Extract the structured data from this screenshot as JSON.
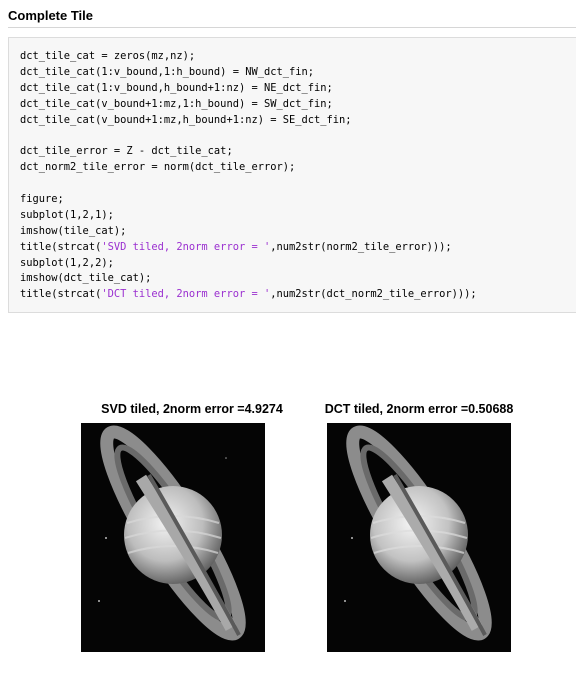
{
  "section": {
    "title": "Complete Tile"
  },
  "code": [
    [
      {
        "t": "dct_tile_cat = zeros(mz,nz);"
      }
    ],
    [
      {
        "t": "dct_tile_cat(1:v_bound,1:h_bound) = NW_dct_fin;"
      }
    ],
    [
      {
        "t": "dct_tile_cat(1:v_bound,h_bound+1:nz) = NE_dct_fin;"
      }
    ],
    [
      {
        "t": "dct_tile_cat(v_bound+1:mz,1:h_bound) = SW_dct_fin;"
      }
    ],
    [
      {
        "t": "dct_tile_cat(v_bound+1:mz,h_bound+1:nz) = SE_dct_fin;"
      }
    ],
    [
      {
        "t": ""
      }
    ],
    [
      {
        "t": "dct_tile_error = Z - dct_tile_cat;"
      }
    ],
    [
      {
        "t": "dct_norm2_tile_error = norm(dct_tile_error);"
      }
    ],
    [
      {
        "t": ""
      }
    ],
    [
      {
        "t": "figure;"
      }
    ],
    [
      {
        "t": "subplot(1,2,1);"
      }
    ],
    [
      {
        "t": "imshow(tile_cat);"
      }
    ],
    [
      {
        "t": "title(strcat("
      },
      {
        "t": "'SVD tiled, 2norm error = '",
        "s": true
      },
      {
        "t": ",num2str(norm2_tile_error)));"
      }
    ],
    [
      {
        "t": "subplot(1,2,2);"
      }
    ],
    [
      {
        "t": "imshow(dct_tile_cat);"
      }
    ],
    [
      {
        "t": "title(strcat("
      },
      {
        "t": "'DCT tiled, 2norm error = '",
        "s": true
      },
      {
        "t": ",num2str(dct_norm2_tile_error)));"
      }
    ]
  ],
  "figure": {
    "panels": [
      {
        "title": "SVD tiled, 2norm error =4.9274",
        "image": "saturn-grayscale"
      },
      {
        "title": "DCT tiled, 2norm error =0.50688",
        "image": "saturn-grayscale"
      }
    ]
  },
  "colors": {
    "string": "#9b30d0",
    "code_bg": "#f7f7f7"
  }
}
